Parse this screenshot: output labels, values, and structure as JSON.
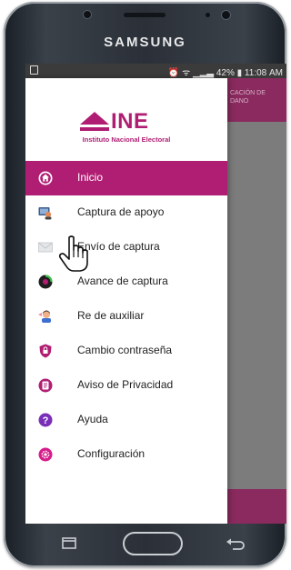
{
  "device": {
    "brand": "SAMSUNG"
  },
  "status_bar": {
    "right_text": "⏰ ᯤ ▁▂▃ 42% ▮ 11:08 AM"
  },
  "background_app": {
    "header_text": "CACIÓN DE DANO"
  },
  "drawer": {
    "logo": {
      "name": "INE",
      "subtitle": "Instituto Nacional Electoral"
    },
    "menu": [
      {
        "label": "Inicio",
        "icon": "home-icon",
        "active": true
      },
      {
        "label": "Captura de apoyo",
        "icon": "capture-support-icon"
      },
      {
        "label": "Envío de captura",
        "icon": "envelope-icon"
      },
      {
        "label": "Avance de captura",
        "icon": "progress-icon"
      },
      {
        "label": "Re        de auxiliar",
        "icon": "auxiliary-icon"
      },
      {
        "label": "Cambio contraseña",
        "icon": "lock-icon"
      },
      {
        "label": "Aviso de Privacidad",
        "icon": "privacy-icon"
      },
      {
        "label": "Ayuda",
        "icon": "help-icon"
      },
      {
        "label": "Configuración",
        "icon": "settings-icon"
      }
    ]
  },
  "colors": {
    "accent": "#b01e73",
    "background_header": "#8a2a5f"
  }
}
